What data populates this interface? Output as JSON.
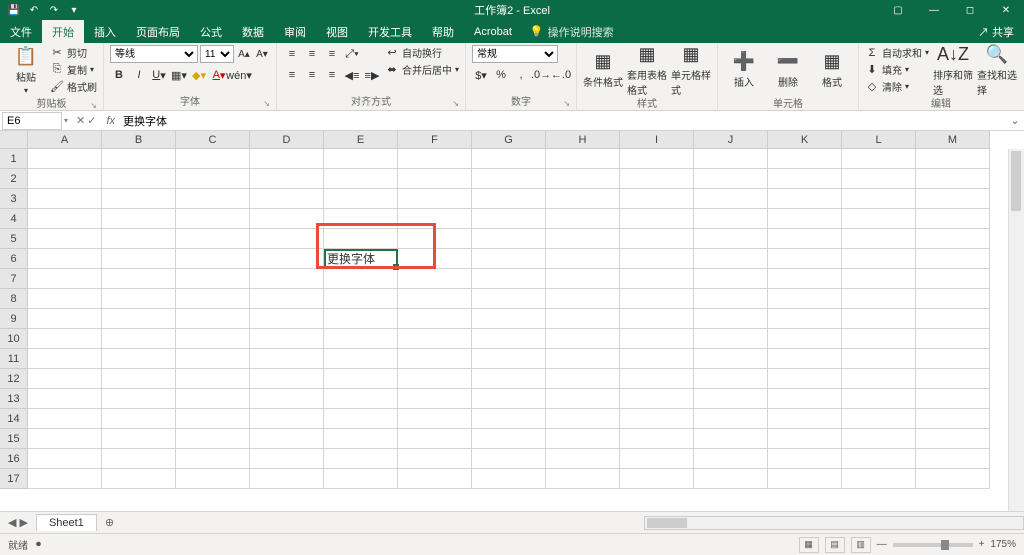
{
  "title": "工作簿2 - Excel",
  "share": "共享",
  "menu": {
    "file": "文件",
    "home": "开始",
    "insert": "插入",
    "layout": "页面布局",
    "formulas": "公式",
    "data": "数据",
    "review": "审阅",
    "view": "视图",
    "dev": "开发工具",
    "help": "帮助",
    "acrobat": "Acrobat",
    "tellme": "操作说明搜索"
  },
  "clip": {
    "paste": "粘贴",
    "cut": "剪切",
    "copy": "复制",
    "painter": "格式刷",
    "label": "剪贴板"
  },
  "font": {
    "name": "等线",
    "size": "11",
    "label": "字体"
  },
  "align": {
    "wrap": "自动换行",
    "merge": "合并后居中",
    "label": "对齐方式"
  },
  "number": {
    "format": "常规",
    "label": "数字"
  },
  "styles": {
    "cond": "条件格式",
    "table": "套用表格格式",
    "cell": "单元格样式",
    "label": "样式"
  },
  "cells": {
    "insert": "插入",
    "delete": "删除",
    "format": "格式",
    "label": "单元格"
  },
  "editing": {
    "sum": "自动求和",
    "fill": "填充",
    "clear": "清除",
    "sort": "排序和筛选",
    "find": "查找和选择",
    "label": "编辑"
  },
  "namebox": "E6",
  "formula": "更换字体",
  "cellE6": "更换字体",
  "cols": [
    "A",
    "B",
    "C",
    "D",
    "E",
    "F",
    "G",
    "H",
    "I",
    "J",
    "K",
    "L",
    "M"
  ],
  "rowcount": 17,
  "sheet1": "Sheet1",
  "status": "就绪",
  "zoom": "175%"
}
